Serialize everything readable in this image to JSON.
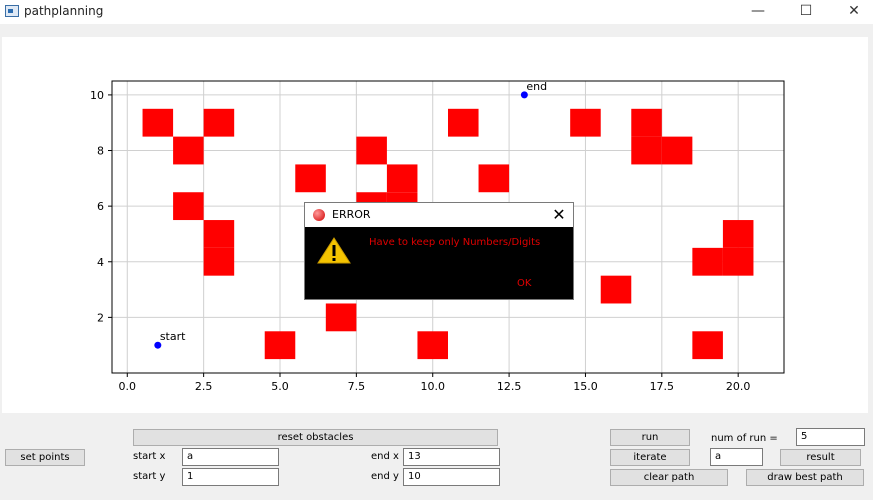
{
  "window": {
    "title": "pathplanning",
    "minimize": "—",
    "maximize": "☐",
    "close": "✕",
    "icon": "app-window-icon"
  },
  "chart_data": {
    "type": "scatter",
    "xlim": [
      -0.5,
      21.5
    ],
    "ylim": [
      0,
      10.5
    ],
    "xticks": [
      "0.0",
      "2.5",
      "5.0",
      "7.5",
      "10.0",
      "12.5",
      "15.0",
      "17.5",
      "20.0"
    ],
    "yticks": [
      "2",
      "4",
      "6",
      "8",
      "10"
    ],
    "grid": true,
    "points": [
      {
        "label": "start",
        "x": 1,
        "y": 1
      },
      {
        "label": "end",
        "x": 13,
        "y": 10
      }
    ],
    "obstacles": [
      [
        1,
        9
      ],
      [
        3,
        9
      ],
      [
        11,
        9
      ],
      [
        15,
        9
      ],
      [
        17,
        9
      ],
      [
        2,
        8
      ],
      [
        8,
        8
      ],
      [
        17,
        8
      ],
      [
        18,
        8
      ],
      [
        6,
        7
      ],
      [
        9,
        7
      ],
      [
        12,
        7
      ],
      [
        2,
        6
      ],
      [
        8,
        6
      ],
      [
        9,
        6
      ],
      [
        3,
        5
      ],
      [
        20,
        5
      ],
      [
        3,
        4
      ],
      [
        19,
        4
      ],
      [
        20,
        4
      ],
      [
        16,
        3
      ],
      [
        7,
        2
      ],
      [
        5,
        1
      ],
      [
        10,
        1
      ],
      [
        19,
        1
      ]
    ],
    "colors": {
      "obstacle": "#ff0000",
      "point": "#0000ff"
    }
  },
  "dialog": {
    "title": "ERROR",
    "message": "Have to keep only Numbers/Digits",
    "ok": "OK",
    "close": "✕",
    "icon": "warning-icon"
  },
  "controls": {
    "reset_obstacles": "reset obstacles",
    "set_points": "set points",
    "start_x_label": "start x",
    "start_x_value": "a",
    "start_y_label": "start y",
    "start_y_value": "1",
    "end_x_label": "end x",
    "end_x_value": "13",
    "end_y_label": "end y",
    "end_y_value": "10",
    "run": "run",
    "num_of_run_label": "num of run =",
    "num_of_run_value": "5",
    "iterate": "iterate",
    "iterate_value": "a",
    "result": "result",
    "clear_path": "clear path",
    "draw_best_path": "draw best path"
  }
}
